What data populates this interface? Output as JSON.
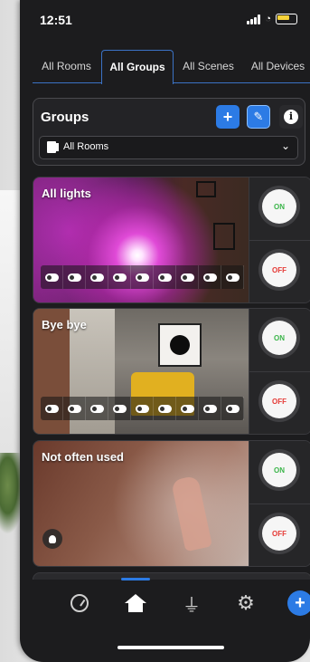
{
  "status_bar": {
    "time": "12:51"
  },
  "tabs": [
    {
      "label": "All Rooms",
      "active": false
    },
    {
      "label": "All Groups",
      "active": true
    },
    {
      "label": "All Scenes",
      "active": false
    },
    {
      "label": "All Devices",
      "active": false
    }
  ],
  "groups_header": {
    "title": "Groups",
    "add_label": "+",
    "info_label": "i",
    "room_selector": {
      "selected": "All Rooms"
    }
  },
  "groups": [
    {
      "name": "All lights",
      "on_label": "ON",
      "off_label": "OFF"
    },
    {
      "name": "Bye bye",
      "on_label": "ON",
      "off_label": "OFF"
    },
    {
      "name": "Not often used",
      "on_label": "ON",
      "off_label": "OFF"
    }
  ],
  "bottom_nav": {
    "plus_label": "+"
  },
  "colors": {
    "accent": "#2c7be5",
    "on": "#3bb54a",
    "off": "#e53935"
  }
}
